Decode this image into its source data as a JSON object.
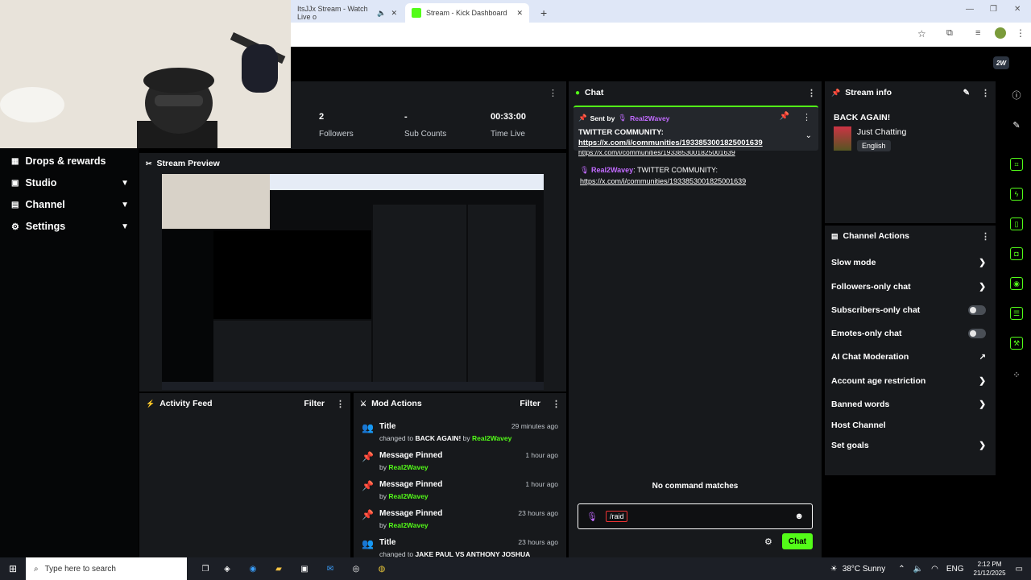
{
  "browser": {
    "tabs": [
      {
        "label": "ItsJJx Stream - Watch Live o",
        "active": false
      },
      {
        "label": "Stream - Kick Dashboard",
        "active": true
      }
    ]
  },
  "nav": {
    "items": [
      {
        "label": "Drops & rewards",
        "icon": "grid-icon"
      },
      {
        "label": "Studio",
        "icon": "studio-icon"
      },
      {
        "label": "Channel",
        "icon": "channel-icon"
      },
      {
        "label": "Settings",
        "icon": "gear-icon"
      }
    ]
  },
  "avatar_badge": "2W",
  "stats": [
    {
      "value": "2",
      "label": "Followers"
    },
    {
      "value": "-",
      "label": "Sub Counts"
    },
    {
      "value": "00:33:00",
      "label": "Time Live"
    }
  ],
  "preview": {
    "title": "Stream Preview"
  },
  "activity": {
    "title": "Activity Feed",
    "filter": "Filter"
  },
  "mod": {
    "title": "Mod Actions",
    "filter": "Filter",
    "items": [
      {
        "title": "Title",
        "ago": "29 minutes ago",
        "prefix": "changed to",
        "value": "BACK AGAIN!",
        "by": "by",
        "user": "Real2Wavey"
      },
      {
        "title": "Message Pinned",
        "ago": "1 hour ago",
        "by": "by",
        "user": "Real2Wavey"
      },
      {
        "title": "Message Pinned",
        "ago": "1 hour ago",
        "by": "by",
        "user": "Real2Wavey"
      },
      {
        "title": "Message Pinned",
        "ago": "23 hours ago",
        "by": "by",
        "user": "Real2Wavey"
      },
      {
        "title": "Title",
        "ago": "23 hours ago",
        "prefix": "changed to",
        "value": "JAKE PAUL VS ANTHONY JOSHUA"
      }
    ]
  },
  "chat": {
    "title": "Chat",
    "pinned": {
      "sent_by": "Sent by",
      "user": "Real2Wavey",
      "text": "TWITTER COMMUNITY:",
      "link": "https://x.com/i/communities/1933853001825001639"
    },
    "cut_link": "https://x.com/i/communities/1933853001825001639",
    "message": {
      "user": "Real2Wavey",
      "text": ": TWITTER COMMUNITY:",
      "link": "https://x.com/i/communities/1933853001825001639"
    },
    "no_matches": "No command matches",
    "input_value": "/raid",
    "send_label": "Chat"
  },
  "stream_info": {
    "title": "Stream info",
    "stream_title": "BACK AGAIN!",
    "category": "Just Chatting",
    "language": "English"
  },
  "channel_actions": {
    "title": "Channel Actions",
    "items": [
      {
        "label": "Slow mode",
        "control": "chevron"
      },
      {
        "label": "Followers-only chat",
        "control": "chevron"
      },
      {
        "label": "Subscribers-only chat",
        "control": "toggle"
      },
      {
        "label": "Emotes-only chat",
        "control": "toggle"
      },
      {
        "label": "AI Chat Moderation",
        "control": "external"
      },
      {
        "label": "Account age restriction",
        "control": "chevron"
      },
      {
        "label": "Banned words",
        "control": "chevron"
      },
      {
        "label": "Host Channel",
        "control": "none"
      },
      {
        "label": "Set goals",
        "control": "chevron"
      }
    ]
  },
  "taskbar": {
    "search_placeholder": "Type here to search",
    "weather": "38°C  Sunny",
    "lang": "ENG",
    "time": "2:12 PM",
    "date": "21/12/2025"
  },
  "colors": {
    "accent": "#53fc18",
    "user": "#c26bff",
    "panel": "#17191c"
  }
}
